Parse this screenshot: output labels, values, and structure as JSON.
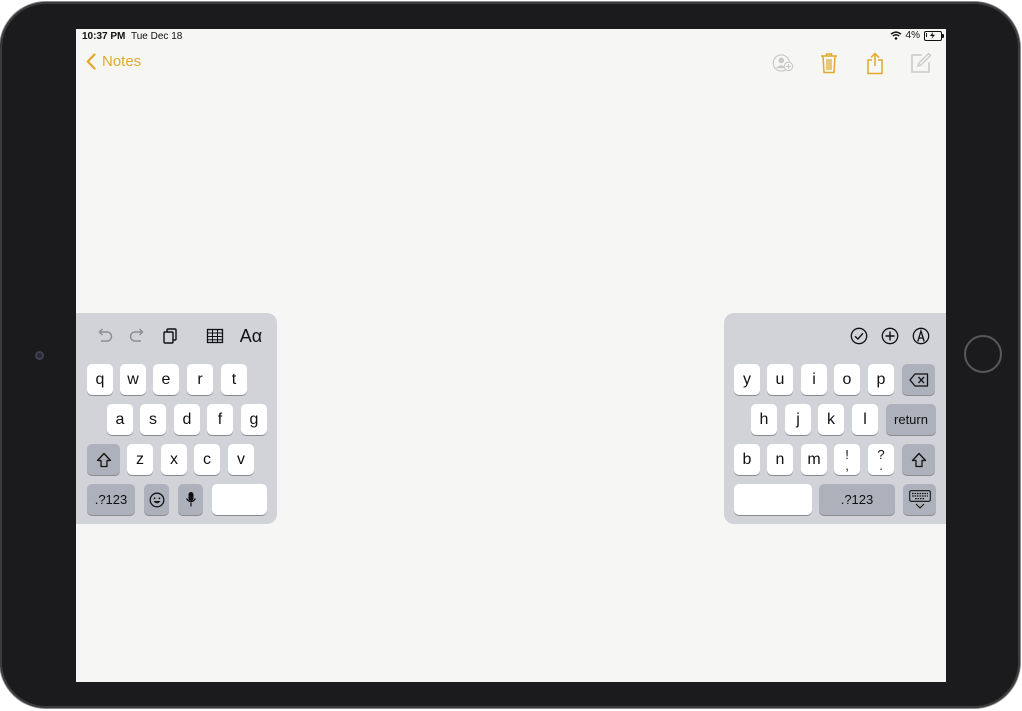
{
  "status_bar": {
    "time": "10:37 PM",
    "date": "Tue Dec 18",
    "battery_percent": "4%",
    "battery_level": 0.04
  },
  "nav": {
    "back_label": "Notes"
  },
  "toolbar_icons": [
    "add-person-icon",
    "trash-icon",
    "share-icon",
    "compose-icon"
  ],
  "colors": {
    "accent": "#e2a82a",
    "screen_bg": "#f6f6f5",
    "keyboard_bg": "#d1d3d9",
    "key_dark": "#adb1bb"
  },
  "keyboard_left": {
    "quicktype_icons": [
      "undo-icon",
      "redo-icon",
      "paste-icon",
      "table-icon",
      "format-icon"
    ],
    "format_label": "Aα",
    "row1": [
      "q",
      "w",
      "e",
      "r",
      "t"
    ],
    "row2": [
      "a",
      "s",
      "d",
      "f",
      "g"
    ],
    "row3": [
      "z",
      "x",
      "c",
      "v"
    ],
    "numbers_label": ".?123"
  },
  "keyboard_right": {
    "quicktype_icons": [
      "checklist-icon",
      "add-icon",
      "markup-icon"
    ],
    "row1": [
      "y",
      "u",
      "i",
      "o",
      "p"
    ],
    "row2": [
      "h",
      "j",
      "k",
      "l"
    ],
    "row3": [
      "b",
      "n",
      "m"
    ],
    "punct": [
      {
        "top": "!",
        "bottom": ","
      },
      {
        "top": "?",
        "bottom": "."
      }
    ],
    "return_label": "return",
    "numbers_label": ".?123"
  }
}
